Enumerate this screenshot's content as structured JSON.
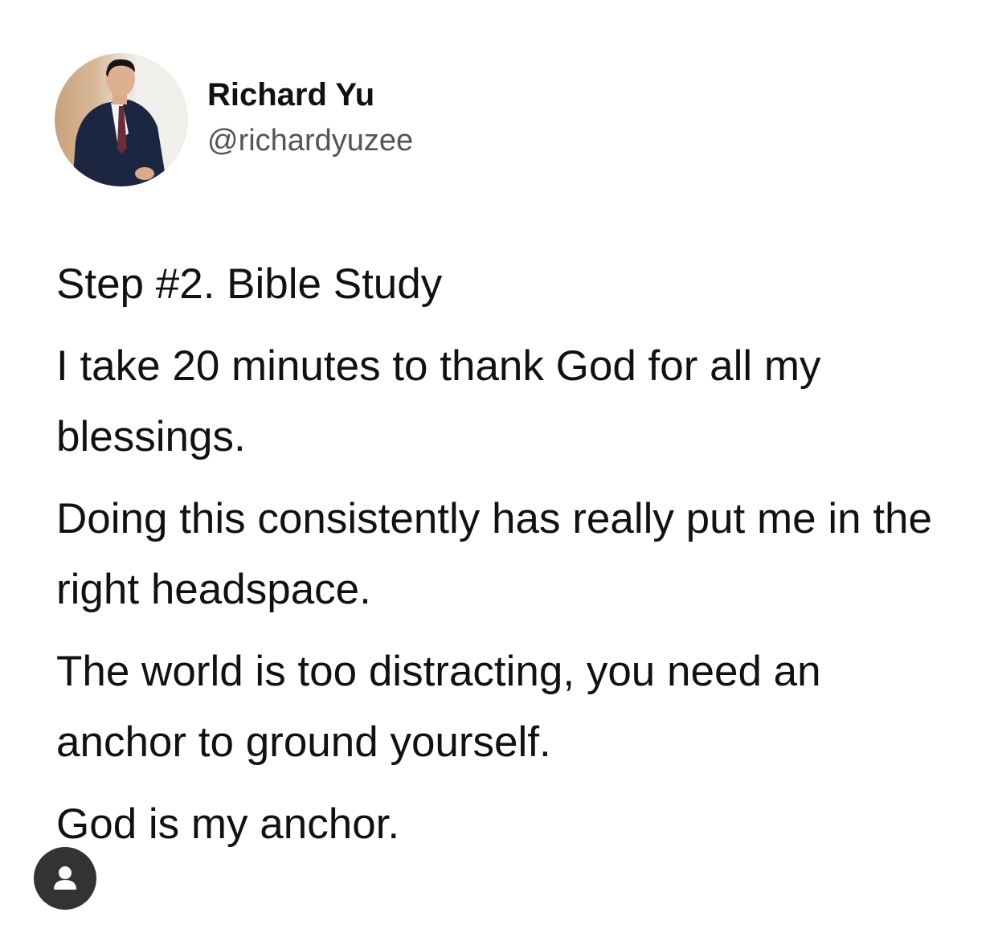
{
  "author": {
    "display_name": "Richard Yu",
    "handle": "@richardyuzee"
  },
  "tweet": {
    "paragraphs": [
      "Step #2. Bible Study",
      "I take 20 minutes to thank God for all my blessings.",
      "Doing this consistently has really put me in the right headspace.",
      "The world is too distracting, you need an anchor to ground yourself.",
      "God is my anchor."
    ]
  },
  "icons": {
    "avatar": "profile-photo",
    "overlay_badge": "user-icon"
  }
}
